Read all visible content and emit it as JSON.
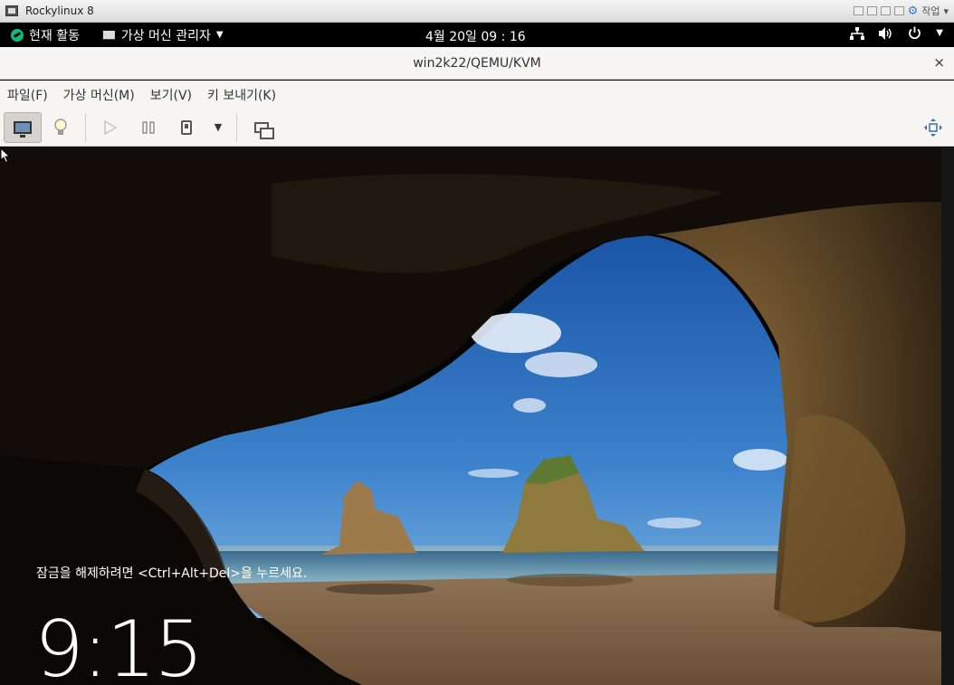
{
  "host": {
    "title": "Rockylinux 8",
    "right_label": "작업"
  },
  "topbar": {
    "activities": "현재 활동",
    "app_menu": "가상 머신 관리자",
    "clock": "4월 20일  09 : 16"
  },
  "viewer": {
    "title": "win2k22/QEMU/KVM",
    "close": "×",
    "menus": [
      "파일(F)",
      "가상 머신(M)",
      "보기(V)",
      "키 보내기(K)"
    ]
  },
  "vm_screen": {
    "unlock_message": "잠금을 해제하려면 <Ctrl+Alt+Del>을 누르세요.",
    "time": "9:15"
  },
  "icons": {
    "console": "monitor-icon",
    "details": "lightbulb-icon",
    "run": "play-icon",
    "pause": "pause-icon",
    "shutdown": "power-icon",
    "snapshots": "snapshots-icon",
    "fullscreen": "fullscreen-icon",
    "network": "network-icon",
    "volume": "volume-icon",
    "power": "power-menu-icon"
  },
  "colors": {
    "gnome_bar": "#000000",
    "rocky_green": "#10b981",
    "viewer_bg": "#f6f5f4"
  }
}
